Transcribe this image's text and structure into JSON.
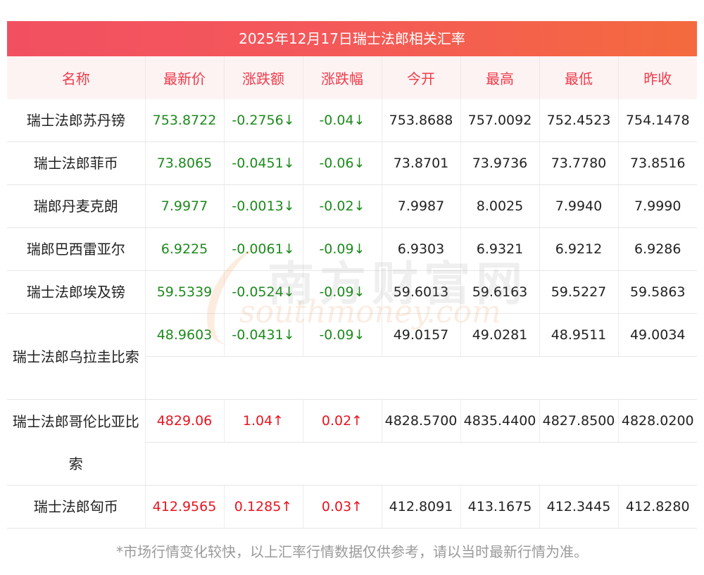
{
  "title": "2025年12月17日瑞士法郎相关汇率",
  "headers": [
    "名称",
    "最新价",
    "涨跌额",
    "涨跌幅",
    "今开",
    "最高",
    "最低",
    "昨收"
  ],
  "rows": [
    {
      "name": "瑞士法郎苏丹镑",
      "latest": "753.8722",
      "change": "-0.2756↓",
      "pct": "-0.04↓",
      "open": "753.8688",
      "high": "757.0092",
      "low": "752.4523",
      "prev": "754.1478",
      "dir": "down"
    },
    {
      "name": "瑞士法郎菲币",
      "latest": "73.8065",
      "change": "-0.0451↓",
      "pct": "-0.06↓",
      "open": "73.8701",
      "high": "73.9736",
      "low": "73.7780",
      "prev": "73.8516",
      "dir": "down"
    },
    {
      "name": "瑞郎丹麦克朗",
      "latest": "7.9977",
      "change": "-0.0013↓",
      "pct": "-0.02↓",
      "open": "7.9987",
      "high": "8.0025",
      "low": "7.9940",
      "prev": "7.9990",
      "dir": "down"
    },
    {
      "name": "瑞郎巴西雷亚尔",
      "latest": "6.9225",
      "change": "-0.0061↓",
      "pct": "-0.09↓",
      "open": "6.9303",
      "high": "6.9321",
      "low": "6.9212",
      "prev": "6.9286",
      "dir": "down"
    },
    {
      "name": "瑞士法郎埃及镑",
      "latest": "59.5339",
      "change": "-0.0524↓",
      "pct": "-0.09↓",
      "open": "59.6013",
      "high": "59.6163",
      "low": "59.5227",
      "prev": "59.5863",
      "dir": "down"
    },
    {
      "name": "瑞士法郎乌拉圭比索",
      "latest": "48.9603",
      "change": "-0.0431↓",
      "pct": "-0.09↓",
      "open": "49.0157",
      "high": "49.0281",
      "low": "48.9511",
      "prev": "49.0034",
      "dir": "down"
    },
    {
      "name": "瑞士法郎哥伦比亚比索",
      "latest": "4829.06",
      "change": "1.04↑",
      "pct": "0.02↑",
      "open": "4828.5700",
      "high": "4835.4400",
      "low": "4827.8500",
      "prev": "4828.0200",
      "dir": "up"
    },
    {
      "name": "瑞士法郎匈币",
      "latest": "412.9565",
      "change": "0.1285↑",
      "pct": "0.03↑",
      "open": "412.8091",
      "high": "413.1675",
      "low": "412.3445",
      "prev": "412.8280",
      "dir": "up"
    }
  ],
  "footer": "*市场行情变化较快，以上汇率行情数据仅供参考，请以当时最新行情为准。",
  "watermark": {
    "cn": "南方财富网",
    "en": "southmoney.com"
  },
  "colors": {
    "up": "#e8141f",
    "down": "#1d8a1d",
    "header_text": "#ef3b4a",
    "title_bg_start": "#f25061",
    "title_bg_end": "#f46a3e"
  }
}
